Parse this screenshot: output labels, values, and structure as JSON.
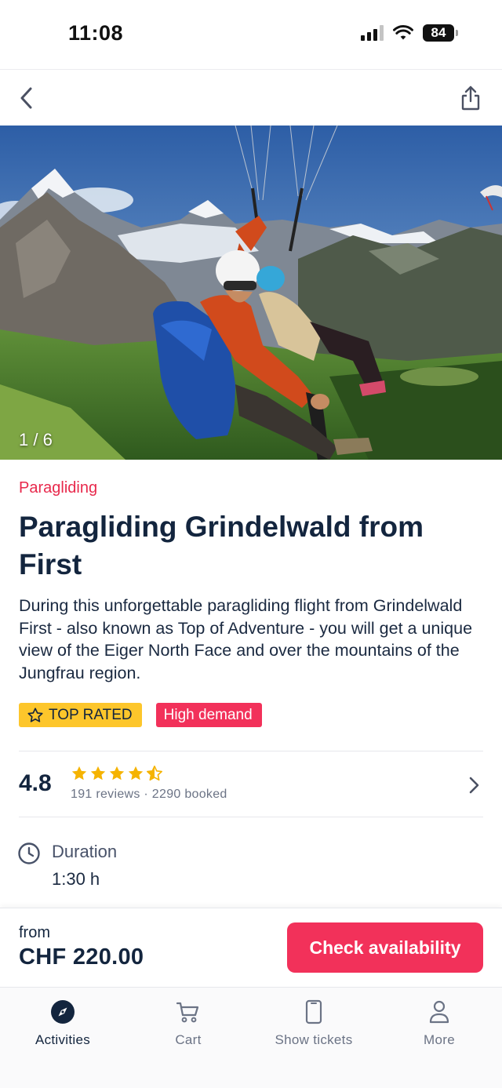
{
  "status_bar": {
    "time": "11:08",
    "battery": "84"
  },
  "header": {
    "back_icon": "chevron-left-icon",
    "share_icon": "share-icon"
  },
  "gallery": {
    "counter": "1 / 6"
  },
  "activity": {
    "category": "Paragliding",
    "title": "Paragliding Grindelwald from First",
    "description": "During this unforgettable paragliding flight from Grindelwald First - also known as Top of Adventure - you will get a unique view of the Eiger North Face and over the mountains of the Jungfrau region.",
    "badges": {
      "top_rated": "TOP RATED",
      "high_demand": "High demand"
    }
  },
  "rating": {
    "score": "4.8",
    "stars": 4.5,
    "meta": "191 reviews · 2290 booked"
  },
  "duration": {
    "label": "Duration",
    "value": "1:30 h"
  },
  "booking": {
    "from_label": "from",
    "price": "CHF 220.00",
    "cta": "Check availability"
  },
  "tabs": [
    {
      "label": "Activities",
      "icon": "compass-icon",
      "active": true
    },
    {
      "label": "Cart",
      "icon": "cart-icon",
      "active": false
    },
    {
      "label": "Show tickets",
      "icon": "phone-ticket-icon",
      "active": false
    },
    {
      "label": "More",
      "icon": "person-icon",
      "active": false
    }
  ],
  "colors": {
    "accent": "#f2315a",
    "category": "#e8294c",
    "badge_yellow": "#fdc62b",
    "text_dark": "#13253e",
    "star": "#f5b301"
  }
}
